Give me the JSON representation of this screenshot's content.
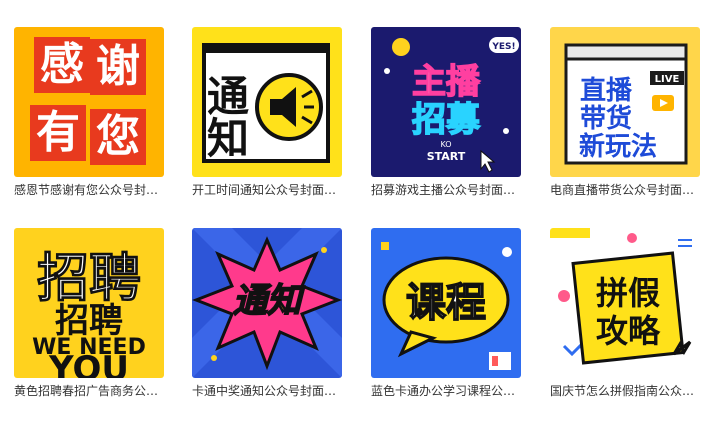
{
  "cards": [
    {
      "caption": "感恩节感谢有您公众号封面首图",
      "art": [
        "感",
        "谢",
        "有",
        "您"
      ]
    },
    {
      "caption": "开工时间通知公众号封面首图",
      "art": [
        "通",
        "知"
      ]
    },
    {
      "caption": "招募游戏主播公众号封面首图",
      "art": [
        "主播",
        "招募",
        "YES!",
        "KO",
        "START"
      ]
    },
    {
      "caption": "电商直播带货公众号封面首图",
      "art": [
        "直播",
        "带货",
        "新玩法",
        "LIVE"
      ]
    },
    {
      "caption": "黄色招聘春招广告商务公众号封面首图",
      "art": [
        "招聘",
        "招聘",
        "WE NEED",
        "YOU"
      ]
    },
    {
      "caption": "卡通中奖通知公众号封面首图",
      "art": [
        "通知"
      ]
    },
    {
      "caption": "蓝色卡通办公学习课程公众号封面首图",
      "art": [
        "课程"
      ]
    },
    {
      "caption": "国庆节怎么拼假指南公众号封面首图",
      "art": [
        "拼假",
        "攻略"
      ]
    }
  ]
}
